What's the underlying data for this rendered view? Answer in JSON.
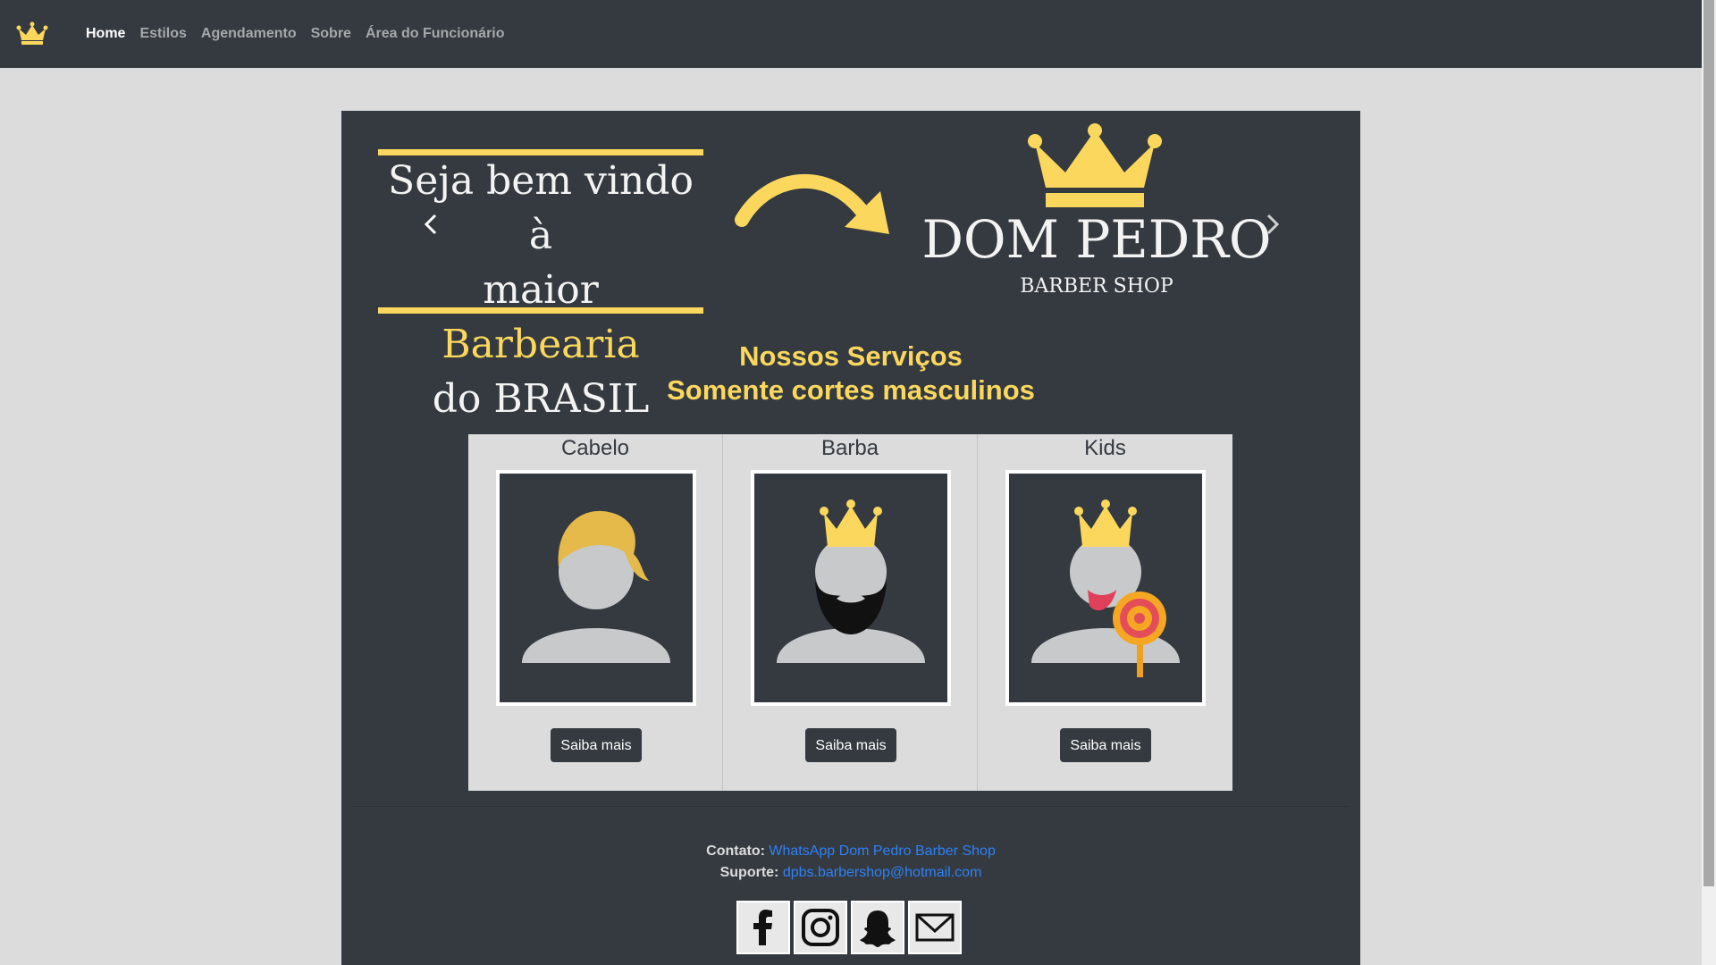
{
  "nav": {
    "brand_icon": "crown-icon",
    "links": [
      {
        "label": "Home",
        "active": true
      },
      {
        "label": "Estilos",
        "active": false
      },
      {
        "label": "Agendamento",
        "active": false
      },
      {
        "label": "Sobre",
        "active": false
      },
      {
        "label": "Área do Funcionário",
        "active": false
      }
    ]
  },
  "carousel": {
    "welcome_line1": "Seja bem vindo à",
    "welcome_line2_prefix": "maior ",
    "welcome_line2_highlight": "Barbearia",
    "welcome_line3": "do BRASIL",
    "logo_name": "DOM PEDRO",
    "logo_subtitle": "BARBER SHOP",
    "prev_icon": "chevron-left-icon",
    "next_icon": "chevron-right-icon"
  },
  "services": {
    "title": "Nossos Serviços",
    "subtitle": "Somente cortes masculinos",
    "cards": [
      {
        "title": "Cabelo",
        "button": "Saiba mais",
        "icon": "hair-avatar-icon"
      },
      {
        "title": "Barba",
        "button": "Saiba mais",
        "icon": "beard-avatar-icon"
      },
      {
        "title": "Kids",
        "button": "Saiba mais",
        "icon": "kid-avatar-icon"
      }
    ]
  },
  "footer": {
    "contact_label": "Contato:",
    "contact_link": "WhatsApp Dom Pedro Barber Shop",
    "support_label": "Suporte:",
    "support_link": "dpbs.barbershop@hotmail.com",
    "socials": [
      "facebook-icon",
      "instagram-icon",
      "snapchat-icon",
      "mail-icon"
    ]
  },
  "colors": {
    "dark": "#343a40",
    "accent_yellow": "#fbd85d",
    "link_blue": "#2f81f7",
    "page_bg": "#dcdcdc"
  }
}
